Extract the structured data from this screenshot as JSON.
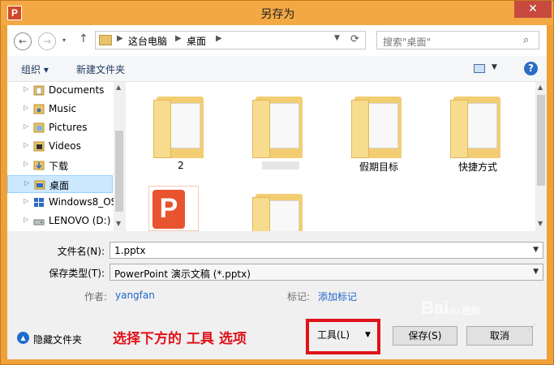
{
  "window": {
    "title": "另存为",
    "app_letter": "P"
  },
  "nav": {
    "back_glyph": "←",
    "forward_glyph": "→",
    "up_glyph": "↑",
    "breadcrumb": [
      "这台电脑",
      "桌面"
    ],
    "search_placeholder": "搜索\"桌面\""
  },
  "toolbar": {
    "organize": "组织 ▾",
    "new_folder": "新建文件夹",
    "help": "?"
  },
  "tree": [
    {
      "label": "Documents",
      "icon": "documents-library-icon"
    },
    {
      "label": "Music",
      "icon": "music-library-icon"
    },
    {
      "label": "Pictures",
      "icon": "pictures-library-icon"
    },
    {
      "label": "Videos",
      "icon": "videos-library-icon"
    },
    {
      "label": "下载",
      "icon": "downloads-folder-icon"
    },
    {
      "label": "桌面",
      "icon": "desktop-folder-icon",
      "selected": true
    },
    {
      "label": "Windows8_OS",
      "icon": "windows-drive-icon"
    },
    {
      "label": "LENOVO (D:)",
      "icon": "drive-icon"
    }
  ],
  "files": [
    {
      "label": "2"
    },
    {
      "label": ""
    },
    {
      "label": "假期目标"
    },
    {
      "label": "快捷方式"
    },
    {
      "label": ""
    },
    {
      "label": ""
    }
  ],
  "form": {
    "filename_label": "文件名(N):",
    "filename_value": "1.pptx",
    "type_label": "保存类型(T):",
    "type_value": "PowerPoint 演示文稿 (*.pptx)",
    "author_label": "作者:",
    "author_value": "yangfan",
    "tags_label": "标记:",
    "tags_value": "添加标记"
  },
  "footer": {
    "hide_folders": "隐藏文件夹",
    "annotation": "选择下方的  工具  选项",
    "tools": "工具(L)",
    "save": "保存(S)",
    "cancel": "取消"
  },
  "watermark": {
    "text": "Bai",
    "sub": "du 经验"
  },
  "colors": {
    "window_frame": "#f0a038",
    "close": "#c74a3e",
    "annotation": "#e0121a",
    "selection": "#cce8ff",
    "link": "#1e66c8"
  }
}
